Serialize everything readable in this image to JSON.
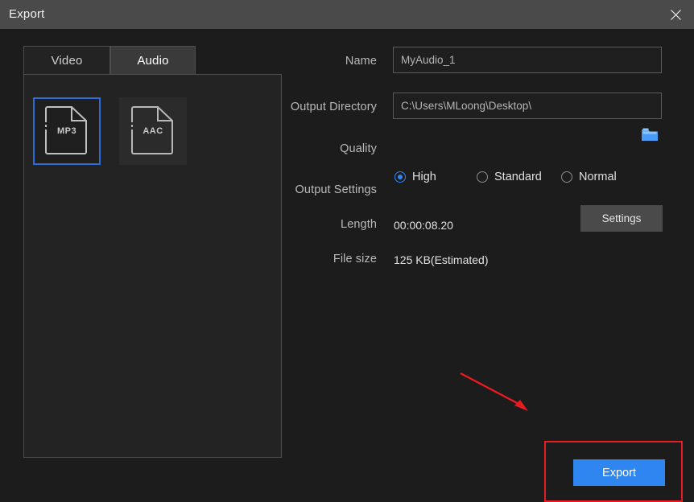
{
  "window": {
    "title": "Export",
    "close_icon": "close-icon"
  },
  "tabs": [
    {
      "id": "video",
      "label": "Video",
      "active": false
    },
    {
      "id": "audio",
      "label": "Audio",
      "active": true
    }
  ],
  "formats": [
    {
      "id": "mp3",
      "label": "MP3",
      "icon": "file-icon",
      "selected": true
    },
    {
      "id": "aac",
      "label": "AAC",
      "icon": "file-icon",
      "selected": false
    }
  ],
  "form": {
    "name": {
      "label": "Name",
      "value": "MyAudio_1",
      "placeholder": "MyAudio_1"
    },
    "output_directory": {
      "label": "Output Directory",
      "value": "C:\\Users\\MLoong\\Desktop\\",
      "placeholder": "C:\\Users\\MLoong\\Desktop\\",
      "browse_icon": "folder-icon"
    },
    "quality": {
      "label": "Quality",
      "selected": "High",
      "options": [
        {
          "label": "High",
          "checked": true
        },
        {
          "label": "Standard",
          "checked": false
        },
        {
          "label": "Normal",
          "checked": false
        }
      ]
    },
    "output_settings": {
      "label": "Output Settings",
      "button_label": "Settings"
    },
    "length": {
      "label": "Length",
      "value": "00:00:08.20"
    },
    "file_size": {
      "label": "File size",
      "value": "125 KB(Estimated)"
    }
  },
  "actions": {
    "export_label": "Export"
  },
  "annotation": {
    "highlight_color": "#e81b23",
    "arrow_color": "#e81b23"
  },
  "colors": {
    "accent_blue": "#2f86f0",
    "selection_blue": "#2a6dd4",
    "titlebar": "#4a4a4a",
    "background": "#1c1c1c",
    "panel": "#232323"
  }
}
